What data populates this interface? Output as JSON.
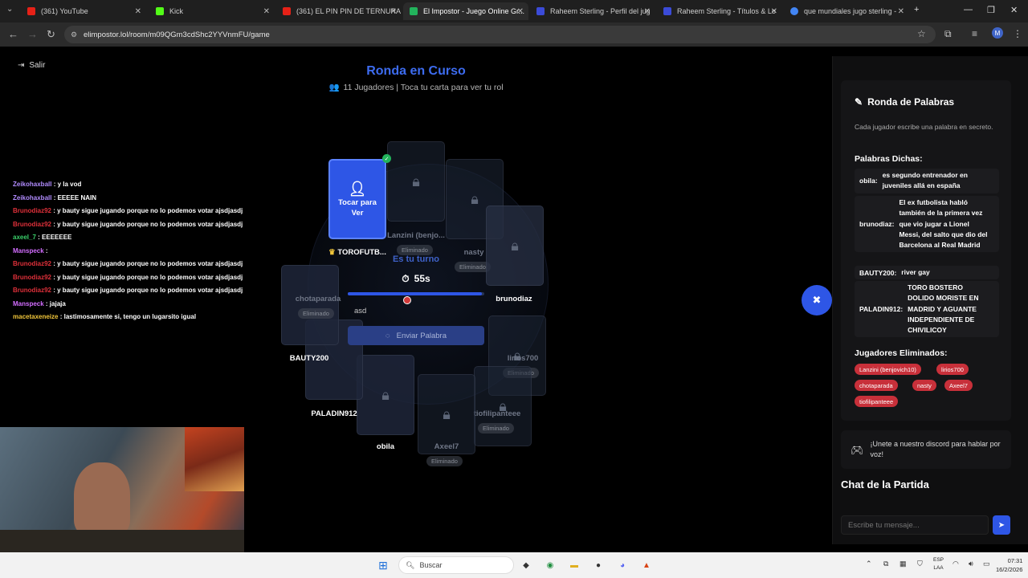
{
  "browser": {
    "tabs": [
      {
        "label": "(361) YouTube",
        "color": "#e62117"
      },
      {
        "label": "Kick",
        "color": "#53fc18"
      },
      {
        "label": "(361) EL PIN PIN DE TERNURA",
        "color": "#e62117"
      },
      {
        "label": "El Impostor - Juego Online Gr...",
        "color": "#22b35c"
      },
      {
        "label": "Raheem Sterling - Perfil del jug",
        "color": "#3b4bd8"
      },
      {
        "label": "Raheem Sterling - Títulos & Lo",
        "color": "#3b4bd8"
      },
      {
        "label": "que mundiales jugo sterling -",
        "color": "#4285f4"
      }
    ],
    "url": "elimpostor.lol/room/m09QGm3cdShc2YYVnmFU/game",
    "profile_initial": "M"
  },
  "game": {
    "exit_label": "Salir",
    "title": "Ronda en Curso",
    "subtitle": "11 Jugadores | Toca tu carta para ver tu rol",
    "my_card_label": "Tocar para Ver",
    "my_name": "TOROFUTB...",
    "turn_label": "Es tu turno",
    "timer": "55s",
    "progress_fraction": 0.98,
    "word_input_value": "asd",
    "send_label": "Enviar Palabra",
    "eliminated_tag": "Eliminado",
    "players": {
      "lanzini": "Lanzini (benjo...",
      "nasty": "nasty",
      "brunodiaz": "brunodiaz",
      "lirios": "lirios700",
      "tiofili": "tiofilipanteee",
      "axeel": "Axeel7",
      "obila": "obila",
      "paladin": "PALADIN912",
      "bauty": "BAUTY200",
      "chota": "chotaparada"
    }
  },
  "stream_chat": [
    {
      "user": "Zeikohaxball",
      "text": ": y la vod",
      "color": "#b28cff"
    },
    {
      "user": "Zeikohaxball",
      "text": ": EEEEE NAIN",
      "color": "#b28cff"
    },
    {
      "user": "Brunodiaz92",
      "text": ": y bauty sigue jugando porque no lo podemos votar ajsdjasdj",
      "color": "#e0303a"
    },
    {
      "user": "Brunodiaz92",
      "text": ": y bauty sigue jugando porque no lo podemos votar ajsdjasdj",
      "color": "#e0303a"
    },
    {
      "user": "axeel_7",
      "text": ": EEEEEEE",
      "color": "#3ad06a"
    },
    {
      "user": "Manspeck",
      "text": ":",
      "color": "#d36dff"
    },
    {
      "user": "Brunodiaz92",
      "text": ": y bauty sigue jugando porque no lo podemos votar ajsdjasdj",
      "color": "#e0303a"
    },
    {
      "user": "Brunodiaz92",
      "text": ": y bauty sigue jugando porque no lo podemos votar ajsdjasdj",
      "color": "#e0303a"
    },
    {
      "user": "Brunodiaz92",
      "text": ": y bauty sigue jugando porque no lo podemos votar ajsdjasdj",
      "color": "#e0303a"
    },
    {
      "user": "Manspeck",
      "text": ": jajaja",
      "color": "#d36dff"
    },
    {
      "user": "macetaxeneize",
      "text": ": lastimosamente si, tengo un lugarsito igual",
      "color": "#f0c53a"
    }
  ],
  "panel": {
    "title": "Ronda de Palabras",
    "description": "Cada jugador escribe una palabra en secreto.",
    "said_heading": "Palabras Dichas:",
    "words": [
      {
        "who": "obila:",
        "what": "es segundo entrenador en juveniles allá en españa"
      },
      {
        "who": "brunodiaz:",
        "what": "El ex futbolista habló también de la primera vez que vio jugar a Lionel Messi, del salto que dio del Barcelona al Real Madrid"
      },
      {
        "who": "BAUTY200:",
        "what": "river gay"
      },
      {
        "who": "PALADIN912:",
        "what": "TORO BOSTERO DOLIDO MORISTE EN MADRID Y AGUANTE INDEPENDIENTE DE CHIVILICOY"
      }
    ],
    "eliminated_heading": "Jugadores Eliminados:",
    "eliminated": [
      "Lanzini (benjovich10)",
      "lirios700",
      "chotaparada",
      "nasty",
      "Axeel7",
      "tiofilipanteee"
    ],
    "discord_text": "¡Unete a nuestro discord para hablar por voz!",
    "chat_heading": "Chat de la Partida",
    "chat_placeholder": "Escribe tu mensaje..."
  },
  "taskbar": {
    "search_label": "Buscar",
    "lang_top": "ESP",
    "lang_bottom": "LAA",
    "time": "07:31",
    "date": "16/2/2026"
  }
}
